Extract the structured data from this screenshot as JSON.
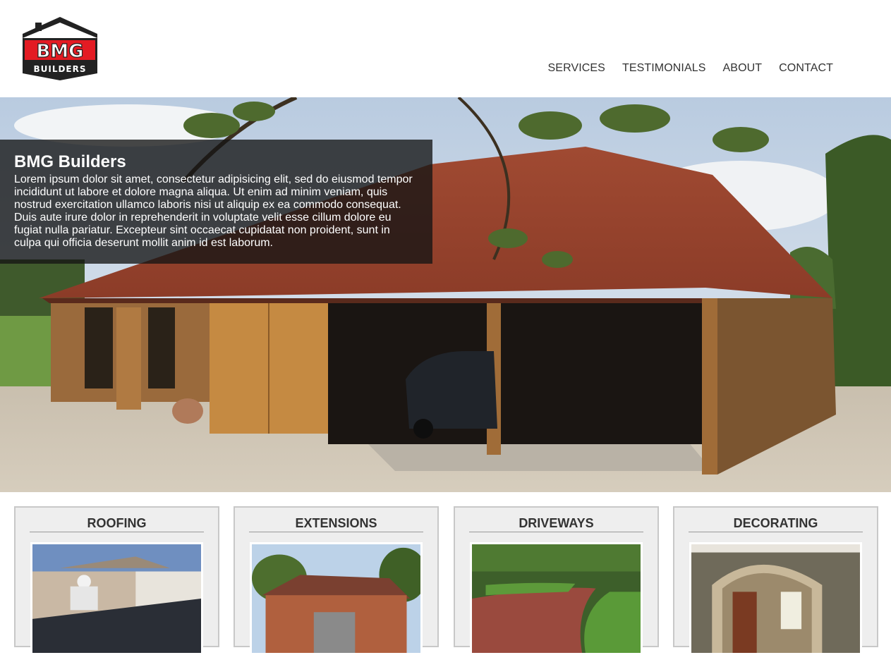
{
  "brand": {
    "logo_top": "BMG",
    "logo_bottom": "BUILDERS",
    "colors": {
      "red": "#e31b23",
      "dark": "#222222"
    }
  },
  "nav": {
    "items": [
      {
        "label": "SERVICES"
      },
      {
        "label": "TESTIMONIALS"
      },
      {
        "label": "ABOUT"
      },
      {
        "label": "CONTACT"
      }
    ]
  },
  "hero": {
    "image": "oak-framed-garage-photo",
    "title": "BMG Builders",
    "text": "Lorem ipsum dolor sit amet, consectetur adipisicing elit, sed do eiusmod tempor incididunt ut labore et dolore magna aliqua. Ut enim ad minim veniam, quis nostrud exercitation ullamco laboris nisi ut aliquip ex ea commodo consequat. Duis aute irure dolor in reprehenderit in voluptate velit esse cillum dolore eu fugiat nulla pariatur. Excepteur sint occaecat cupidatat non proident, sunt in culpa qui officia deserunt mollit anim id est laborum."
  },
  "services": [
    {
      "title": "ROOFING",
      "image": "roofer-photo"
    },
    {
      "title": "EXTENSIONS",
      "image": "brick-house-photo"
    },
    {
      "title": "DRIVEWAYS",
      "image": "block-paved-driveway-photo"
    },
    {
      "title": "DECORATING",
      "image": "interior-archway-photo"
    }
  ]
}
